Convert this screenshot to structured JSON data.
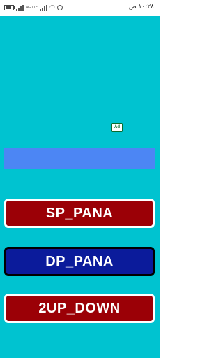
{
  "status_bar": {
    "time": "١٠:٢٨ ص",
    "network_small_text": "4G\nLTE"
  },
  "ad": {
    "badge_label": "Ad",
    "banner_color": "#4c86f4"
  },
  "buttons": [
    {
      "label": "SP_PANA",
      "bg": "#9b0006"
    },
    {
      "label": "DP_PANA",
      "bg": "#0b1b9b"
    },
    {
      "label": "2UP_DOWN",
      "bg": "#9b0006"
    }
  ],
  "colors": {
    "background": "#00c3d0"
  }
}
